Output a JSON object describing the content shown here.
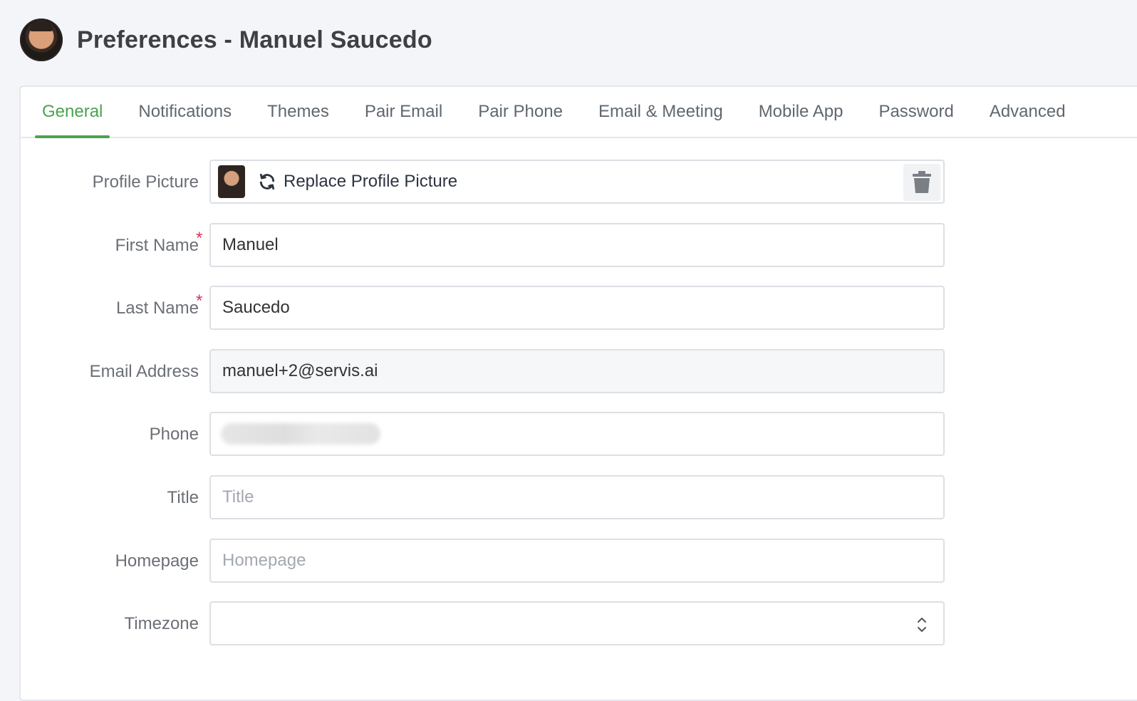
{
  "header": {
    "title": "Preferences - Manuel Saucedo"
  },
  "tabs": [
    {
      "label": "General",
      "active": true
    },
    {
      "label": "Notifications",
      "active": false
    },
    {
      "label": "Themes",
      "active": false
    },
    {
      "label": "Pair Email",
      "active": false
    },
    {
      "label": "Pair Phone",
      "active": false
    },
    {
      "label": "Email & Meeting",
      "active": false
    },
    {
      "label": "Mobile App",
      "active": false
    },
    {
      "label": "Password",
      "active": false
    },
    {
      "label": "Advanced",
      "active": false
    }
  ],
  "form": {
    "profile_picture": {
      "label": "Profile Picture",
      "replace_label": "Replace Profile Picture"
    },
    "first_name": {
      "label": "First Name",
      "required_mark": "*",
      "value": "Manuel"
    },
    "last_name": {
      "label": "Last Name",
      "required_mark": "*",
      "value": "Saucedo"
    },
    "email": {
      "label": "Email Address",
      "value": "manuel+2@servis.ai"
    },
    "phone": {
      "label": "Phone",
      "value": ""
    },
    "title": {
      "label": "Title",
      "value": "",
      "placeholder": "Title"
    },
    "homepage": {
      "label": "Homepage",
      "value": "",
      "placeholder": "Homepage"
    },
    "timezone": {
      "label": "Timezone",
      "value": ""
    }
  },
  "colors": {
    "accent": "#4aa34f",
    "required": "#e0325b",
    "background": "#f4f5f9"
  },
  "icons": {
    "replace": "refresh-icon",
    "delete": "trash-icon",
    "select": "chevron-up-down-icon"
  }
}
